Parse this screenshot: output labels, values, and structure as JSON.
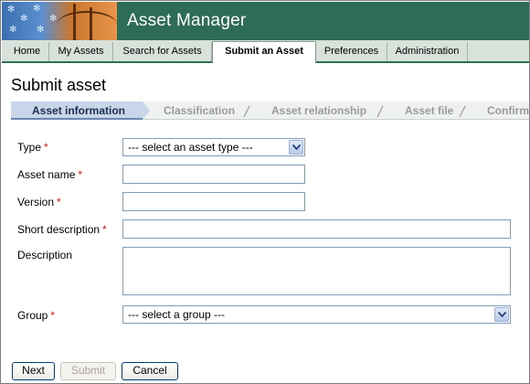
{
  "app": {
    "title": "Asset Manager"
  },
  "nav": {
    "tabs": [
      {
        "label": "Home",
        "active": false
      },
      {
        "label": "My Assets",
        "active": false
      },
      {
        "label": "Search for Assets",
        "active": false
      },
      {
        "label": "Submit an Asset",
        "active": true
      },
      {
        "label": "Preferences",
        "active": false
      },
      {
        "label": "Administration",
        "active": false
      }
    ]
  },
  "page": {
    "title": "Submit asset"
  },
  "wizard": {
    "steps": [
      {
        "label": "Asset information",
        "current": true
      },
      {
        "label": "Classification",
        "current": false
      },
      {
        "label": "Asset relationship",
        "current": false
      },
      {
        "label": "Asset file",
        "current": false
      },
      {
        "label": "Confirm",
        "current": false
      }
    ]
  },
  "form": {
    "required_marker": "*",
    "type": {
      "label": "Type",
      "required": true,
      "selected": "--- select an asset type ---"
    },
    "asset_name": {
      "label": "Asset name",
      "required": true,
      "value": ""
    },
    "version": {
      "label": "Version",
      "required": true,
      "value": ""
    },
    "short_description": {
      "label": "Short description",
      "required": true,
      "value": ""
    },
    "description": {
      "label": "Description",
      "required": false,
      "value": ""
    },
    "group": {
      "label": "Group",
      "required": true,
      "selected": "--- select a group ---"
    }
  },
  "buttons": {
    "next": {
      "label": "Next",
      "enabled": true
    },
    "submit": {
      "label": "Submit",
      "enabled": false
    },
    "cancel": {
      "label": "Cancel",
      "enabled": true
    }
  },
  "colors": {
    "header_bg": "#2e6c55",
    "required_marker": "#dd1111",
    "active_step_bg": "#c9d6ea"
  }
}
